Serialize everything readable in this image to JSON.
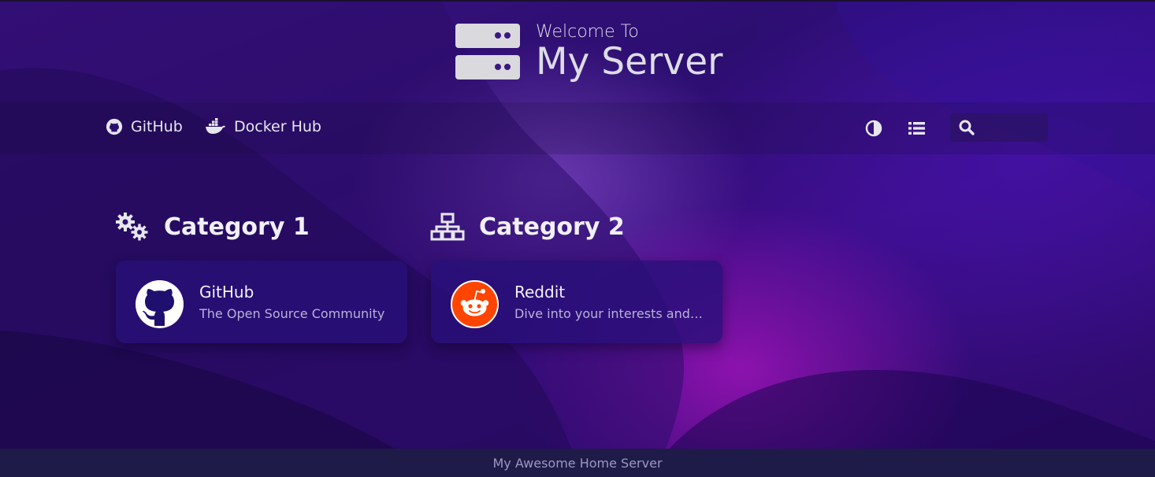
{
  "header": {
    "subtitle": "Welcome To",
    "title": "My Server"
  },
  "navbar": {
    "links": [
      {
        "label": "GitHub",
        "icon": "github-icon"
      },
      {
        "label": "Docker Hub",
        "icon": "docker-icon"
      }
    ],
    "tools": [
      {
        "icon": "contrast-icon"
      },
      {
        "icon": "list-view-icon"
      }
    ],
    "search": {
      "icon": "search-icon",
      "value": ""
    }
  },
  "categories": [
    {
      "title": "Category 1",
      "icon": "cogs-icon",
      "items": [
        {
          "name": "GitHub",
          "subtitle": "The Open Source Community",
          "logo": "github-logo",
          "logo_bg": "#ffffff",
          "logo_fg": "#1f0f6e"
        }
      ]
    },
    {
      "title": "Category 2",
      "icon": "network-icon",
      "items": [
        {
          "name": "Reddit",
          "subtitle": "Dive into your interests and more",
          "logo": "reddit-logo",
          "logo_bg": "#ff4500",
          "logo_fg": "#ffffff"
        }
      ]
    }
  ],
  "footer": {
    "text": "My Awesome Home Server"
  },
  "colors": {
    "background": "#2c0e70",
    "card": "#2a0f7a",
    "text": "#e8e8f0",
    "footer": "#1e1b48",
    "reddit_orange": "#ff4500"
  }
}
